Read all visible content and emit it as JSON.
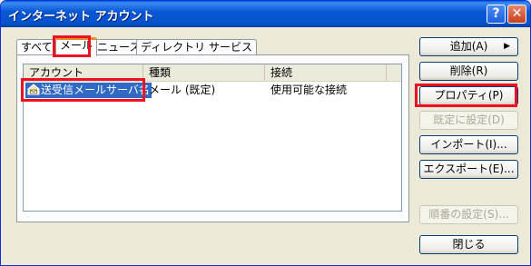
{
  "window": {
    "title": "インターネット アカウント",
    "help_glyph": "?",
    "close_glyph": "✕"
  },
  "tabs": [
    {
      "label": "すべて",
      "active": false
    },
    {
      "label": "メール",
      "active": true
    },
    {
      "label": "ニュース",
      "active": false
    },
    {
      "label": "ディレクトリ サービス",
      "active": false
    }
  ],
  "list": {
    "columns": [
      "アカウント",
      "種類",
      "接続"
    ],
    "rows": [
      {
        "account": "送受信メールサーバ名",
        "type": "メール (既定)",
        "connection": "使用可能な接続",
        "icon": "mail-account-icon",
        "selected": true
      }
    ]
  },
  "buttons": {
    "add": "追加(A)",
    "add_arrow": "▶",
    "remove": "削除(R)",
    "properties": "プロパティ(P)",
    "set_default": "既定に設定(D)",
    "import": "インポート(I)...",
    "export": "エクスポート(E)...",
    "order": "順番の設定(S)...",
    "close": "閉じる"
  },
  "colors": {
    "annotation": "#ee1122",
    "selection": "#316ac5",
    "titlebar": "#0553cc"
  }
}
